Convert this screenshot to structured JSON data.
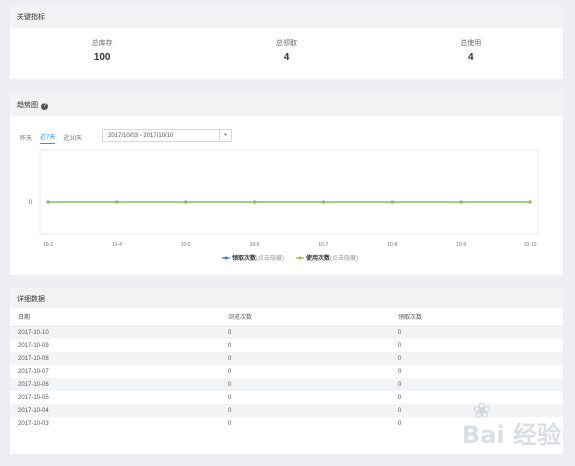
{
  "metrics": {
    "title": "关键指标",
    "items": [
      {
        "label": "总库存",
        "value": "100"
      },
      {
        "label": "总领取",
        "value": "4"
      },
      {
        "label": "总使用",
        "value": "4"
      }
    ]
  },
  "trend": {
    "title": "趋势图",
    "help_icon": "?",
    "tabs": [
      "昨天",
      "近7天",
      "近30天"
    ],
    "active_tab": "近7天",
    "date_range": "2017/10/03 - 2017/10/10",
    "caret": "▾"
  },
  "chart_data": {
    "type": "line",
    "x": [
      "10-3",
      "10-4",
      "10-5",
      "10-6",
      "10-7",
      "10-8",
      "10-9",
      "10-10"
    ],
    "yticks": [
      "0"
    ],
    "series": [
      {
        "name": "领取次数",
        "hint": "(点击隐藏)",
        "values": [
          0,
          0,
          0,
          0,
          0,
          0,
          0,
          0
        ],
        "color": "#3a7bd5"
      },
      {
        "name": "使用次数",
        "hint": "(点击隐藏)",
        "values": [
          0,
          0,
          0,
          0,
          0,
          0,
          0,
          0
        ],
        "color": "#8bc34a"
      }
    ]
  },
  "detail": {
    "title": "详细数据",
    "columns": [
      "日期",
      "浏览次数",
      "领取次数"
    ],
    "rows": [
      [
        "2017-10-10",
        "0",
        "0"
      ],
      [
        "2017-10-09",
        "0",
        "0"
      ],
      [
        "2017-10-08",
        "0",
        "0"
      ],
      [
        "2017-10-07",
        "0",
        "0"
      ],
      [
        "2017-10-06",
        "0",
        "0"
      ],
      [
        "2017-10-05",
        "0",
        "0"
      ],
      [
        "2017-10-04",
        "0",
        "0"
      ],
      [
        "2017-10-03",
        "0",
        "0"
      ]
    ]
  },
  "watermark": "Bai 经验",
  "watermark_icon": "paw-icon"
}
